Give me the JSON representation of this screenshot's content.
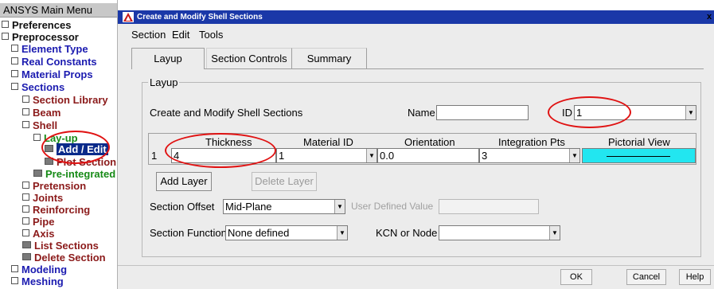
{
  "tree": {
    "title": "ANSYS Main Menu",
    "items": [
      {
        "label": "Preferences",
        "color": "black"
      },
      {
        "label": "Preprocessor",
        "color": "black"
      },
      {
        "label": "Element Type",
        "color": "blue"
      },
      {
        "label": "Real Constants",
        "color": "blue"
      },
      {
        "label": "Material Props",
        "color": "blue"
      },
      {
        "label": "Sections",
        "color": "blue"
      },
      {
        "label": "Section Library",
        "color": "dred"
      },
      {
        "label": "Beam",
        "color": "dred"
      },
      {
        "label": "Shell",
        "color": "dred"
      },
      {
        "label": "Lay-up",
        "color": "green"
      },
      {
        "label": "Add / Edit",
        "color": "selected"
      },
      {
        "label": "Plot Section",
        "color": "dred"
      },
      {
        "label": "Pre-integrated",
        "color": "green"
      },
      {
        "label": "Pretension",
        "color": "dred"
      },
      {
        "label": "Joints",
        "color": "dred"
      },
      {
        "label": "Reinforcing",
        "color": "dred"
      },
      {
        "label": "Pipe",
        "color": "dred"
      },
      {
        "label": "Axis",
        "color": "dred"
      },
      {
        "label": "List Sections",
        "color": "dred"
      },
      {
        "label": "Delete Section",
        "color": "dred"
      },
      {
        "label": "Modeling",
        "color": "blue"
      },
      {
        "label": "Meshing",
        "color": "blue"
      }
    ]
  },
  "dialog": {
    "title": "Create and Modify Shell Sections",
    "close": "x",
    "menu": [
      "Section",
      "Edit",
      "Tools"
    ],
    "tabs": [
      "Layup",
      "Section Controls",
      "Summary"
    ],
    "group_label": "Layup",
    "heading": "Create and Modify Shell Sections",
    "name_label": "Name",
    "name_value": "",
    "id_label": "ID",
    "id_value": "1",
    "table": {
      "headers": [
        "Thickness",
        "Material ID",
        "Orientation",
        "Integration Pts",
        "Pictorial View"
      ],
      "row_index": "1",
      "thickness": "4",
      "material_id": "1",
      "orientation": "0.0",
      "integration_pts": "3"
    },
    "add_layer": "Add Layer",
    "delete_layer": "Delete Layer",
    "offset_label": "Section Offset",
    "offset_value": "Mid-Plane",
    "user_defined_label": "User Defined Value",
    "user_defined_value": "",
    "function_label": "Section Function",
    "function_value": "None defined",
    "kcn_label": "KCN or Node",
    "kcn_value": "",
    "footer": [
      "OK",
      "Cancel",
      "Help"
    ]
  },
  "colors": {
    "titlebar": "#1a38a8",
    "selection": "#0a2a8a",
    "highlight_oval": "#e01212",
    "pictorial_bg": "#22e6f0"
  }
}
